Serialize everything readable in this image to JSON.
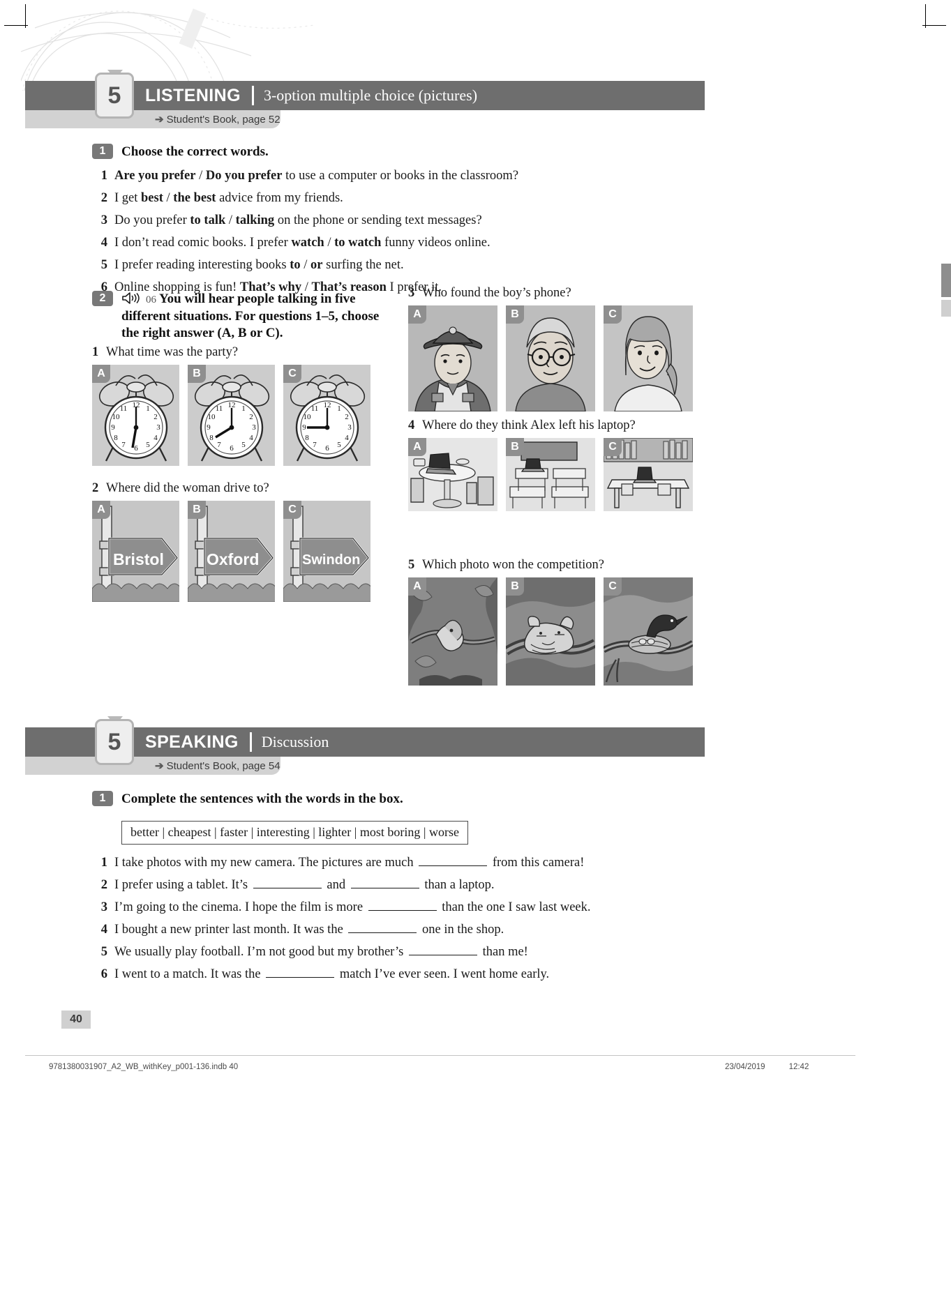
{
  "sections": [
    {
      "number": "5",
      "title": "LISTENING",
      "subtitle": "3-option multiple choice (pictures)",
      "reference": "Student's Book, page 52",
      "arrow_icon": "arrow-right-icon"
    },
    {
      "number": "5",
      "title": "SPEAKING",
      "subtitle": "Discussion",
      "reference": "Student's Book, page 54",
      "arrow_icon": "arrow-right-icon"
    }
  ],
  "listening": {
    "exercise1": {
      "number": "1",
      "rubric": "Choose the correct words.",
      "items": [
        {
          "n": "1",
          "parts": [
            {
              "t": "Are you prefer",
              "b": true
            },
            {
              "t": " / ",
              "b": false
            },
            {
              "t": "Do you prefer",
              "b": true
            },
            {
              "t": " to use a computer or books in the classroom?",
              "b": false
            }
          ]
        },
        {
          "n": "2",
          "parts": [
            {
              "t": "I get ",
              "b": false
            },
            {
              "t": "best",
              "b": true
            },
            {
              "t": " / ",
              "b": false
            },
            {
              "t": "the best",
              "b": true
            },
            {
              "t": " advice from my friends.",
              "b": false
            }
          ]
        },
        {
          "n": "3",
          "parts": [
            {
              "t": "Do you prefer ",
              "b": false
            },
            {
              "t": "to talk",
              "b": true
            },
            {
              "t": " / ",
              "b": false
            },
            {
              "t": "talking",
              "b": true
            },
            {
              "t": " on the phone or sending text messages?",
              "b": false
            }
          ]
        },
        {
          "n": "4",
          "parts": [
            {
              "t": "I don’t read comic books. I prefer ",
              "b": false
            },
            {
              "t": "watch",
              "b": true
            },
            {
              "t": " / ",
              "b": false
            },
            {
              "t": "to watch",
              "b": true
            },
            {
              "t": " funny videos online.",
              "b": false
            }
          ]
        },
        {
          "n": "5",
          "parts": [
            {
              "t": "I prefer reading interesting books ",
              "b": false
            },
            {
              "t": "to",
              "b": true
            },
            {
              "t": " / ",
              "b": false
            },
            {
              "t": "or",
              "b": true
            },
            {
              "t": " surfing the net.",
              "b": false
            }
          ]
        },
        {
          "n": "6",
          "parts": [
            {
              "t": "Online shopping is fun! ",
              "b": false
            },
            {
              "t": "That’s why",
              "b": true
            },
            {
              "t": " / ",
              "b": false
            },
            {
              "t": "That’s reason",
              "b": true
            },
            {
              "t": " I prefer it.",
              "b": false
            }
          ]
        }
      ]
    },
    "exercise2": {
      "number": "2",
      "audio_icon": "speaker-audio-icon",
      "audio_track": "06",
      "rubric": "You will hear people talking in five different situations. For questions 1–5, choose the right answer (A, B or C).",
      "questions": [
        {
          "n": "1",
          "text": "What time was the party?",
          "options": [
            {
              "label": "A",
              "image": "alarm-clock-six-oclock"
            },
            {
              "label": "B",
              "image": "alarm-clock-seven-thirty"
            },
            {
              "label": "C",
              "image": "alarm-clock-nine-oclock"
            }
          ]
        },
        {
          "n": "2",
          "text": "Where did the woman drive to?",
          "options": [
            {
              "label": "A",
              "image": "signpost-bristol",
              "sign_text": "Bristol"
            },
            {
              "label": "B",
              "image": "signpost-oxford",
              "sign_text": "Oxford"
            },
            {
              "label": "C",
              "image": "signpost-swindon",
              "sign_text": "Swindon"
            }
          ]
        },
        {
          "n": "3",
          "text": "Who found the boy’s phone?",
          "options": [
            {
              "label": "A",
              "image": "police-officer-portrait"
            },
            {
              "label": "B",
              "image": "elderly-woman-glasses-portrait"
            },
            {
              "label": "C",
              "image": "young-woman-portrait"
            }
          ]
        },
        {
          "n": "4",
          "text": "Where do they think Alex left his laptop?",
          "options": [
            {
              "label": "A",
              "image": "cafe-table-laptop"
            },
            {
              "label": "B",
              "image": "classroom-desks-laptop"
            },
            {
              "label": "C",
              "image": "library-table-laptop"
            }
          ]
        },
        {
          "n": "5",
          "text": "Which photo won the competition?",
          "options": [
            {
              "label": "A",
              "image": "snake-in-tree-photo"
            },
            {
              "label": "B",
              "image": "sleeping-cat-on-branch-photo"
            },
            {
              "label": "C",
              "image": "bird-at-nest-photo"
            }
          ]
        }
      ]
    }
  },
  "speaking": {
    "exercise1": {
      "number": "1",
      "rubric": "Complete the sentences with the words in the box.",
      "wordbox": "better | cheapest | faster | interesting | lighter | most boring | worse",
      "items": [
        {
          "n": "1",
          "before": "I take photos with my new camera. The pictures are much",
          "mid": "",
          "after": "from this camera!",
          "gaps": 1
        },
        {
          "n": "2",
          "before": "I prefer using a tablet. It’s",
          "mid": "and",
          "after": "than a laptop.",
          "gaps": 2
        },
        {
          "n": "3",
          "before": "I’m going to the cinema. I hope the film is more",
          "mid": "",
          "after": "than the one I saw last week.",
          "gaps": 1
        },
        {
          "n": "4",
          "before": "I bought a new printer last month. It was the",
          "mid": "",
          "after": "one in the shop.",
          "gaps": 1
        },
        {
          "n": "5",
          "before": "We usually play football. I’m not good but my brother’s",
          "mid": "",
          "after": "than me!",
          "gaps": 1
        },
        {
          "n": "6",
          "before": "I went to a match. It was the",
          "mid": "",
          "after": "match I’ve ever seen. I went home early.",
          "gaps": 1
        }
      ]
    }
  },
  "page_number": "40",
  "footer": {
    "left": "9781380031907_A2_WB_withKey_p001-136.indb   40",
    "date": "23/04/2019",
    "time": "12:42"
  }
}
